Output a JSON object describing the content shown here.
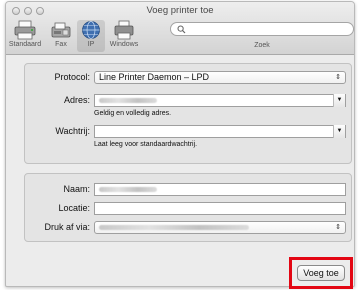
{
  "window": {
    "title": "Voeg printer toe"
  },
  "toolbar": {
    "items": [
      {
        "label": "Standaard",
        "icon": "default-printer-icon"
      },
      {
        "label": "Fax",
        "icon": "fax-icon"
      },
      {
        "label": "IP",
        "icon": "ip-globe-icon",
        "selected": true
      },
      {
        "label": "Windows",
        "icon": "windows-printer-icon"
      }
    ],
    "search": {
      "label": "Zoek",
      "value": "",
      "placeholder": ""
    }
  },
  "form": {
    "protocol": {
      "label": "Protocol:",
      "value": "Line Printer Daemon – LPD"
    },
    "adres": {
      "label": "Adres:",
      "hint": "Geldig en volledig adres."
    },
    "wachtrij": {
      "label": "Wachtrij:",
      "value": "",
      "hint": "Laat leeg voor standaardwachtrij."
    },
    "naam": {
      "label": "Naam:"
    },
    "locatie": {
      "label": "Locatie:",
      "value": ""
    },
    "druk_af_via": {
      "label": "Druk af via:"
    }
  },
  "footer": {
    "add_button": "Voeg toe"
  },
  "colors": {
    "highlight": "#e30613",
    "selected_toolbar": "#d0d0d0"
  }
}
